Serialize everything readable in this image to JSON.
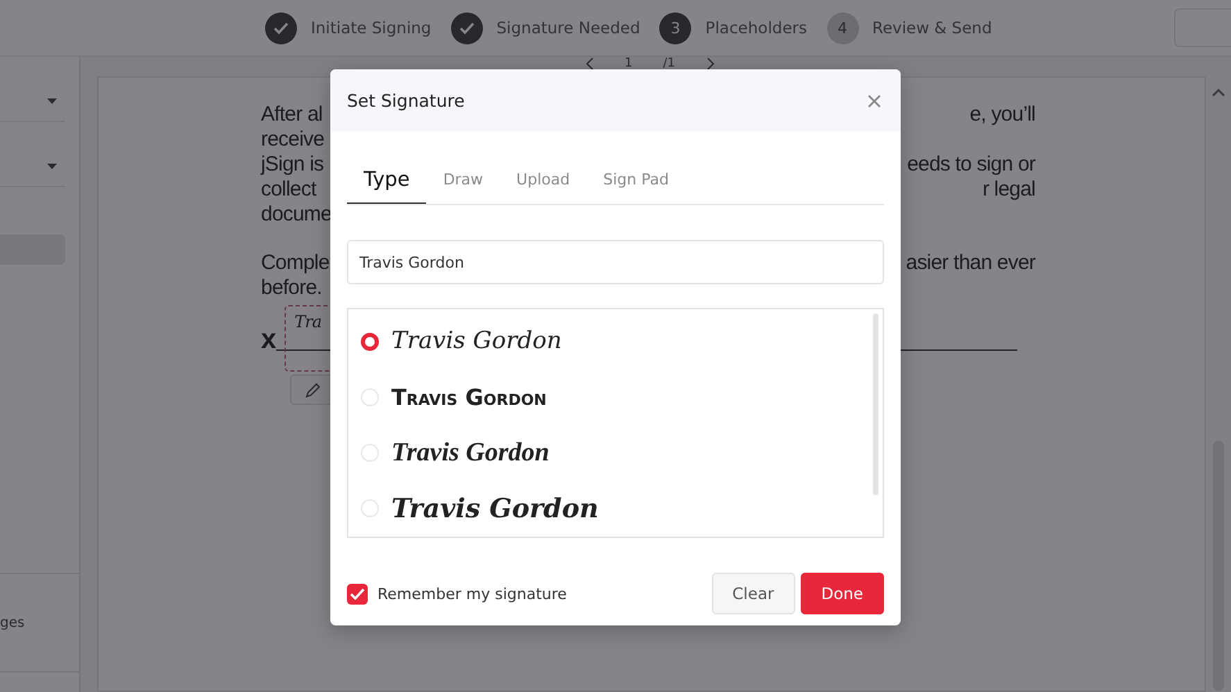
{
  "steps": [
    {
      "kind": "done",
      "label": "Initiate Signing"
    },
    {
      "kind": "done",
      "label": "Signature Needed"
    },
    {
      "kind": "current",
      "number": "3",
      "label": "Placeholders"
    },
    {
      "kind": "todo",
      "number": "4",
      "label": "Review & Send"
    }
  ],
  "pager": {
    "page": "1",
    "total": "/1"
  },
  "sidebar": {
    "footer_text": "ges"
  },
  "document": {
    "paragraphs": [
      [
        {
          "left": "After al",
          "right": "e, you’ll"
        },
        {
          "left": "receive"
        },
        {
          "left": "jSign is",
          "right": "eeds to sign or"
        },
        {
          "left": "collect",
          "right": "r legal"
        },
        {
          "left": "docume"
        }
      ],
      [
        {
          "left": "Comple",
          "right": "asier than ever"
        },
        {
          "left": "before."
        }
      ]
    ],
    "sign_mark": "x",
    "signature_preview": "Tra"
  },
  "modal": {
    "title": "Set Signature",
    "tabs": [
      {
        "label": "Type",
        "selected": true
      },
      {
        "label": "Draw",
        "selected": false
      },
      {
        "label": "Upload",
        "selected": false
      },
      {
        "label": "Sign Pad",
        "selected": false
      }
    ],
    "name_value": "Travis Gordon",
    "options": [
      {
        "kind": "script",
        "text": "Travis Gordon",
        "selected": true
      },
      {
        "kind": "caps",
        "text": "Travis Gordon",
        "selected": false
      },
      {
        "kind": "brush",
        "text": "Travis Gordon",
        "selected": false
      },
      {
        "kind": "bold-brush",
        "text": "Travis Gordon",
        "selected": false
      }
    ],
    "remember": {
      "label": "Remember my signature",
      "checked": true
    },
    "buttons": {
      "clear": "Clear",
      "done": "Done"
    }
  }
}
